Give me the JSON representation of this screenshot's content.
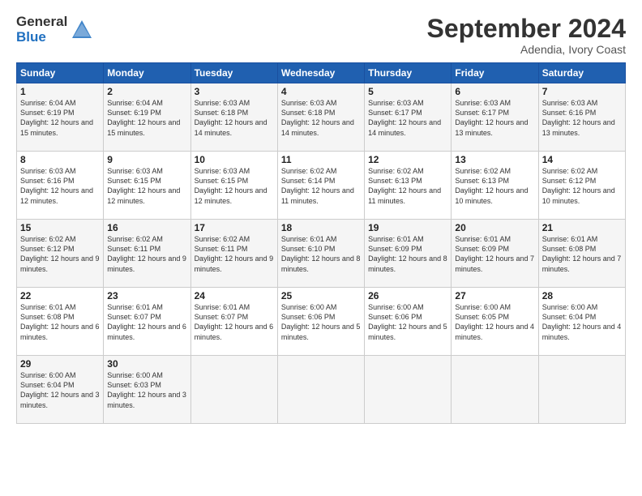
{
  "logo": {
    "general": "General",
    "blue": "Blue"
  },
  "title": "September 2024",
  "location": "Adendia, Ivory Coast",
  "days_of_week": [
    "Sunday",
    "Monday",
    "Tuesday",
    "Wednesday",
    "Thursday",
    "Friday",
    "Saturday"
  ],
  "weeks": [
    [
      {
        "day": "1",
        "sunrise": "6:04 AM",
        "sunset": "6:19 PM",
        "daylight": "12 hours and 15 minutes."
      },
      {
        "day": "2",
        "sunrise": "6:04 AM",
        "sunset": "6:19 PM",
        "daylight": "12 hours and 15 minutes."
      },
      {
        "day": "3",
        "sunrise": "6:03 AM",
        "sunset": "6:18 PM",
        "daylight": "12 hours and 14 minutes."
      },
      {
        "day": "4",
        "sunrise": "6:03 AM",
        "sunset": "6:18 PM",
        "daylight": "12 hours and 14 minutes."
      },
      {
        "day": "5",
        "sunrise": "6:03 AM",
        "sunset": "6:17 PM",
        "daylight": "12 hours and 14 minutes."
      },
      {
        "day": "6",
        "sunrise": "6:03 AM",
        "sunset": "6:17 PM",
        "daylight": "12 hours and 13 minutes."
      },
      {
        "day": "7",
        "sunrise": "6:03 AM",
        "sunset": "6:16 PM",
        "daylight": "12 hours and 13 minutes."
      }
    ],
    [
      {
        "day": "8",
        "sunrise": "6:03 AM",
        "sunset": "6:16 PM",
        "daylight": "12 hours and 12 minutes."
      },
      {
        "day": "9",
        "sunrise": "6:03 AM",
        "sunset": "6:15 PM",
        "daylight": "12 hours and 12 minutes."
      },
      {
        "day": "10",
        "sunrise": "6:03 AM",
        "sunset": "6:15 PM",
        "daylight": "12 hours and 12 minutes."
      },
      {
        "day": "11",
        "sunrise": "6:02 AM",
        "sunset": "6:14 PM",
        "daylight": "12 hours and 11 minutes."
      },
      {
        "day": "12",
        "sunrise": "6:02 AM",
        "sunset": "6:13 PM",
        "daylight": "12 hours and 11 minutes."
      },
      {
        "day": "13",
        "sunrise": "6:02 AM",
        "sunset": "6:13 PM",
        "daylight": "12 hours and 10 minutes."
      },
      {
        "day": "14",
        "sunrise": "6:02 AM",
        "sunset": "6:12 PM",
        "daylight": "12 hours and 10 minutes."
      }
    ],
    [
      {
        "day": "15",
        "sunrise": "6:02 AM",
        "sunset": "6:12 PM",
        "daylight": "12 hours and 9 minutes."
      },
      {
        "day": "16",
        "sunrise": "6:02 AM",
        "sunset": "6:11 PM",
        "daylight": "12 hours and 9 minutes."
      },
      {
        "day": "17",
        "sunrise": "6:02 AM",
        "sunset": "6:11 PM",
        "daylight": "12 hours and 9 minutes."
      },
      {
        "day": "18",
        "sunrise": "6:01 AM",
        "sunset": "6:10 PM",
        "daylight": "12 hours and 8 minutes."
      },
      {
        "day": "19",
        "sunrise": "6:01 AM",
        "sunset": "6:09 PM",
        "daylight": "12 hours and 8 minutes."
      },
      {
        "day": "20",
        "sunrise": "6:01 AM",
        "sunset": "6:09 PM",
        "daylight": "12 hours and 7 minutes."
      },
      {
        "day": "21",
        "sunrise": "6:01 AM",
        "sunset": "6:08 PM",
        "daylight": "12 hours and 7 minutes."
      }
    ],
    [
      {
        "day": "22",
        "sunrise": "6:01 AM",
        "sunset": "6:08 PM",
        "daylight": "12 hours and 6 minutes."
      },
      {
        "day": "23",
        "sunrise": "6:01 AM",
        "sunset": "6:07 PM",
        "daylight": "12 hours and 6 minutes."
      },
      {
        "day": "24",
        "sunrise": "6:01 AM",
        "sunset": "6:07 PM",
        "daylight": "12 hours and 6 minutes."
      },
      {
        "day": "25",
        "sunrise": "6:00 AM",
        "sunset": "6:06 PM",
        "daylight": "12 hours and 5 minutes."
      },
      {
        "day": "26",
        "sunrise": "6:00 AM",
        "sunset": "6:06 PM",
        "daylight": "12 hours and 5 minutes."
      },
      {
        "day": "27",
        "sunrise": "6:00 AM",
        "sunset": "6:05 PM",
        "daylight": "12 hours and 4 minutes."
      },
      {
        "day": "28",
        "sunrise": "6:00 AM",
        "sunset": "6:04 PM",
        "daylight": "12 hours and 4 minutes."
      }
    ],
    [
      {
        "day": "29",
        "sunrise": "6:00 AM",
        "sunset": "6:04 PM",
        "daylight": "12 hours and 3 minutes."
      },
      {
        "day": "30",
        "sunrise": "6:00 AM",
        "sunset": "6:03 PM",
        "daylight": "12 hours and 3 minutes."
      },
      null,
      null,
      null,
      null,
      null
    ]
  ]
}
